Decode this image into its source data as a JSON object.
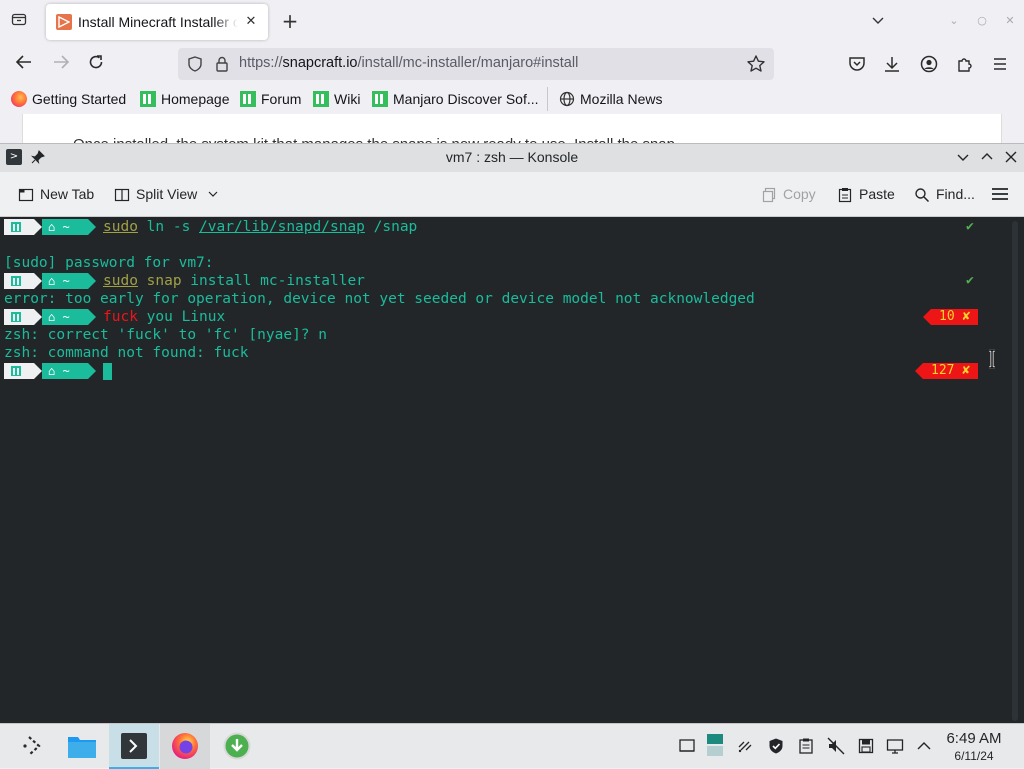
{
  "browser": {
    "tab": {
      "title": "Install Minecraft Installer on Manjaro"
    },
    "url": {
      "prefix": "https://",
      "host": "snapcraft.io",
      "path": "/install/mc-installer/manjaro#install"
    },
    "bookmarks": [
      {
        "label": "Getting Started",
        "icon": "firefox-icon"
      },
      {
        "label": "Homepage",
        "icon": "manjaro-icon"
      },
      {
        "label": "Forum",
        "icon": "manjaro-icon"
      },
      {
        "label": "Wiki",
        "icon": "manjaro-icon"
      },
      {
        "label": "Manjaro Discover Sof...",
        "icon": "manjaro-icon"
      },
      {
        "label": "Mozilla News",
        "icon": "globe-icon"
      }
    ],
    "page_peek_text": "Once installed, the system kit that manages the snaps is now ready to use. Install the snap"
  },
  "konsole": {
    "title": "vm7 : zsh — Konsole",
    "toolbar": {
      "new_tab": "New Tab",
      "split_view": "Split View",
      "copy": "Copy",
      "paste": "Paste",
      "find": "Find..."
    },
    "prompt_dir": "~",
    "lines": {
      "cmd1_sudo": "sudo",
      "cmd1_ln": " ln -s ",
      "cmd1_path": "/var/lib/snapd/snap",
      "cmd1_rest": " /snap",
      "sudo_prompt": "[sudo] password for vm7:",
      "cmd2_sudo": "sudo",
      "cmd2_snap": " snap",
      "cmd2_rest": " install mc-installer",
      "error": "error: too early for operation, device not yet seeded or device model not acknowledged",
      "cmd3_word": "fuck",
      "cmd3_rest": " you Linux",
      "zsh_correct": "zsh: correct 'fuck' to 'fc' [nyae]? n",
      "zsh_notfound": "zsh: command not found: fuck"
    },
    "status": {
      "check": "✔",
      "code1": "10 ✘",
      "code2": "127 ✘"
    }
  },
  "taskbar": {
    "time": "6:49 AM",
    "date": "6/11/24"
  },
  "colors": {
    "terminal_bg": "#232629",
    "terminal_fg": "#1abc9c",
    "error_red": "#ed1515",
    "taskbar_active": "#3daee9"
  }
}
